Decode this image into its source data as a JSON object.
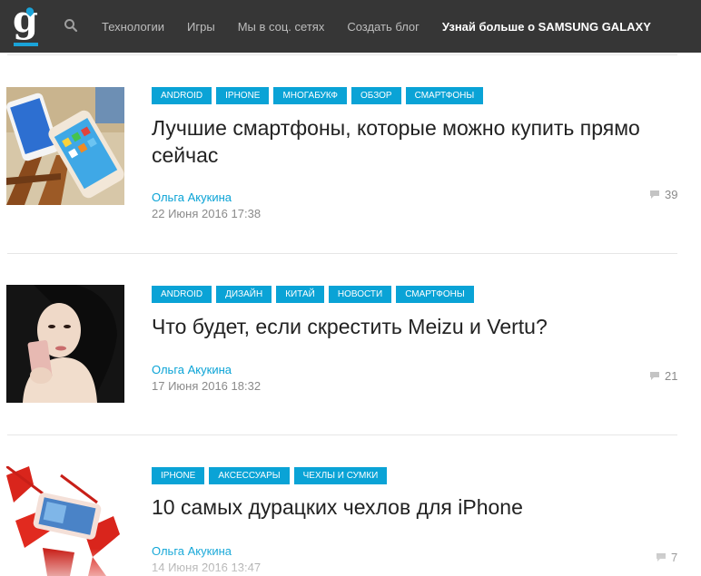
{
  "header": {
    "logo_letter": "g",
    "search_icon": "search-icon",
    "nav": [
      {
        "label": "Технологии"
      },
      {
        "label": "Игры"
      },
      {
        "label": "Мы в соц. сетях"
      },
      {
        "label": "Создать блог"
      },
      {
        "label": "Узнай больше о SAMSUNG GALAXY"
      }
    ]
  },
  "colors": {
    "accent": "#0aa3d6",
    "topbar": "#363636",
    "title": "#222222",
    "meta": "#8a8a8a"
  },
  "articles": [
    {
      "tags": [
        "ANDROID",
        "IPHONE",
        "МНОГАБУКФ",
        "ОБЗОР",
        "СМАРТФОНЫ"
      ],
      "title": "Лучшие смартфоны, которые можно купить прямо сейчас",
      "author": "Ольга Акукина",
      "date": "22 Июня 2016 17:38",
      "comments": "39"
    },
    {
      "tags": [
        "ANDROID",
        "ДИЗАЙН",
        "КИТАЙ",
        "НОВОСТИ",
        "СМАРТФОНЫ"
      ],
      "title": "Что будет, если скрестить Meizu и Vertu?",
      "author": "Ольга Акукина",
      "date": "17 Июня 2016 18:32",
      "comments": "21"
    },
    {
      "tags": [
        "IPHONE",
        "АКСЕССУАРЫ",
        "ЧЕХЛЫ И СУМКИ"
      ],
      "title": "10 самых дурацких чехлов для iPhone",
      "author": "Ольга Акукина",
      "date": "14 Июня 2016 13:47",
      "comments": "7"
    }
  ]
}
